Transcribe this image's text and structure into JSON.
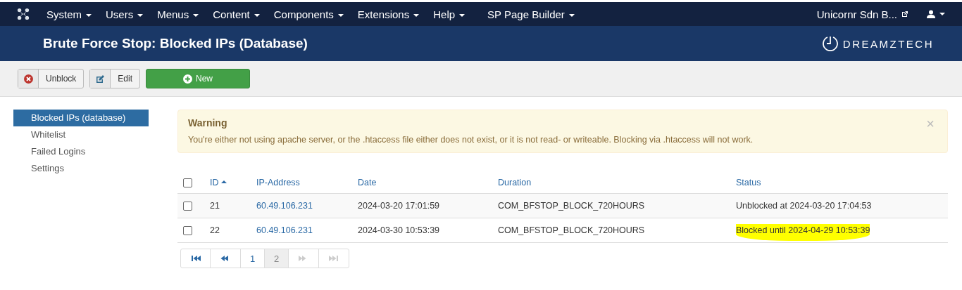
{
  "navbar": {
    "menus": [
      {
        "label": "System"
      },
      {
        "label": "Users"
      },
      {
        "label": "Menus"
      },
      {
        "label": "Content"
      },
      {
        "label": "Components"
      },
      {
        "label": "Extensions"
      },
      {
        "label": "Help"
      },
      {
        "label": "SP Page Builder"
      }
    ],
    "site_link": "Unicornr Sdn B..."
  },
  "header": {
    "title": "Brute Force Stop: Blocked IPs (Database)",
    "logo": "DREAMZTECH"
  },
  "toolbar": [
    {
      "kind": "unblock",
      "label": "Unblock"
    },
    {
      "kind": "edit",
      "label": "Edit"
    },
    {
      "kind": "new",
      "label": "New"
    }
  ],
  "sidebar": {
    "items": [
      {
        "label": "Blocked IPs (database)",
        "selected": true
      },
      {
        "label": "Whitelist",
        "selected": false
      },
      {
        "label": "Failed Logins",
        "selected": false
      },
      {
        "label": "Settings",
        "selected": false
      }
    ]
  },
  "alert": {
    "title": "Warning",
    "message": "You're either not using apache server, or the .htaccess file either does not exist, or it is not read- or writeable. Blocking via .htaccess will not work.",
    "close": "×"
  },
  "table": {
    "select_all_checked": false,
    "columns": [
      {
        "label": "ID",
        "sorted": true
      },
      {
        "label": "IP-Address",
        "sorted": false
      },
      {
        "label": "Date",
        "sorted": false
      },
      {
        "label": "Duration",
        "sorted": false
      },
      {
        "label": "Status",
        "sorted": false
      }
    ],
    "rows": [
      {
        "checked": false,
        "id": "21",
        "ip": "60.49.106.231",
        "date": "2024-03-20 17:01:59",
        "duration": "COM_BFSTOP_BLOCK_720HOURS",
        "status": "Unblocked at 2024-03-20 17:04:53",
        "highlighted": false
      },
      {
        "checked": false,
        "id": "22",
        "ip": "60.49.106.231",
        "date": "2024-03-30 10:53:39",
        "duration": "COM_BFSTOP_BLOCK_720HOURS",
        "status": "Blocked until 2024-04-29 10:53:39",
        "highlighted": true
      }
    ]
  },
  "pagination": [
    {
      "kind": "first",
      "selected": false,
      "disabled": false
    },
    {
      "kind": "prev",
      "selected": false,
      "disabled": false
    },
    {
      "kind": "page",
      "label": "1",
      "selected": false,
      "disabled": false
    },
    {
      "kind": "page",
      "label": "2",
      "selected": true,
      "disabled": false
    },
    {
      "kind": "next",
      "selected": false,
      "disabled": true
    },
    {
      "kind": "last",
      "selected": false,
      "disabled": true
    }
  ]
}
